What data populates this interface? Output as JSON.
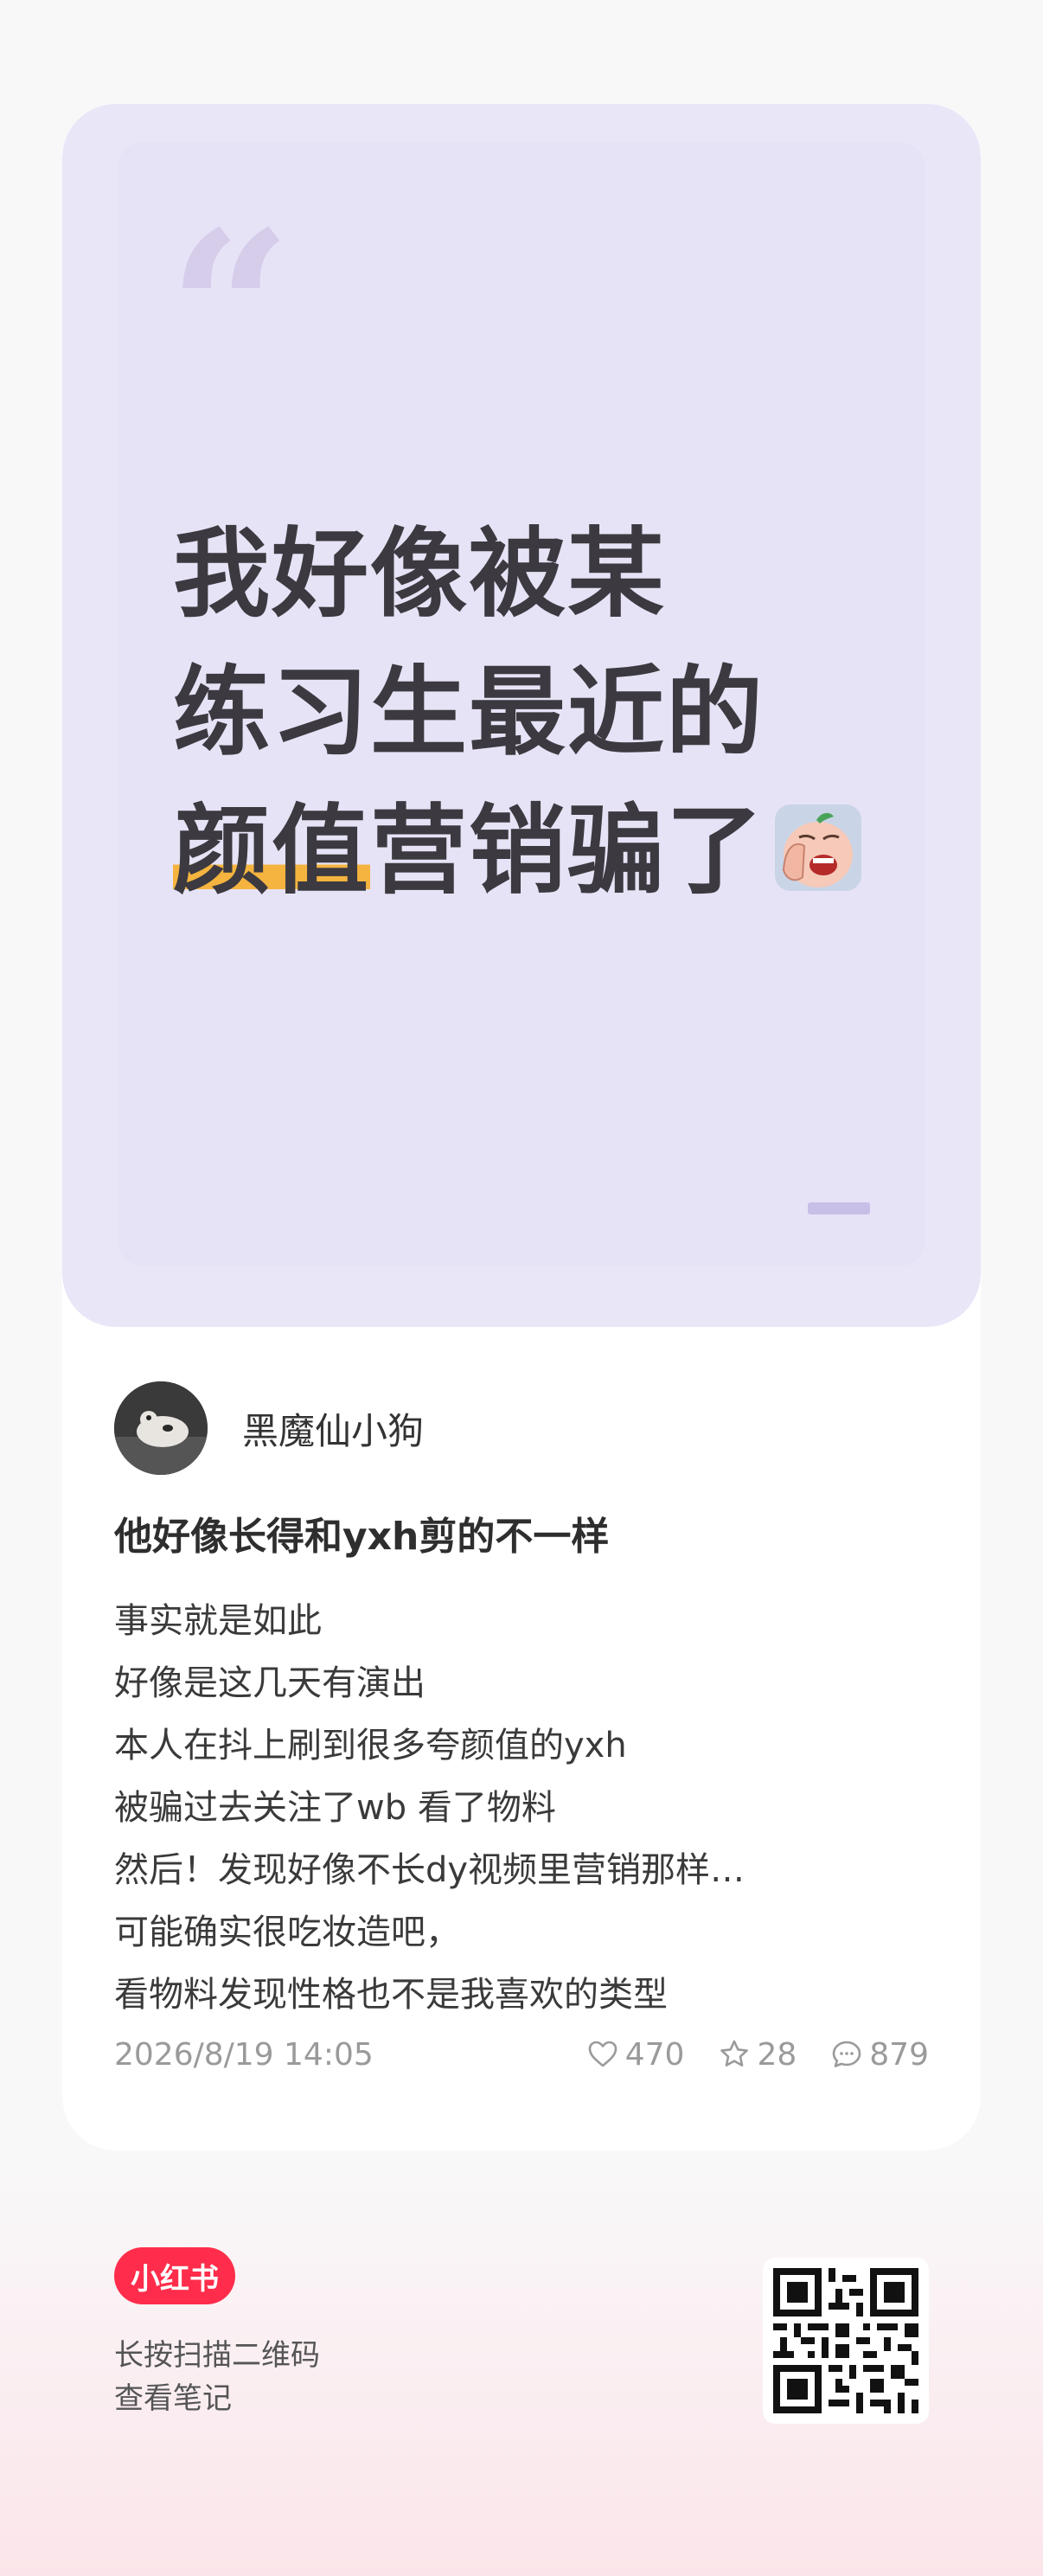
{
  "cover": {
    "quote_glyph": "“",
    "headline_lines": [
      "我好像被某",
      "练习生最近的"
    ],
    "headline_highlight": "颜值",
    "headline_rest": "营销骗了",
    "emoji": "facepalm-emoji"
  },
  "author": {
    "name": "黑魔仙小狗",
    "avatar": "avatar-dog-photo"
  },
  "post": {
    "title": "他好像长得和yxh剪的不一样",
    "lines": [
      "事实就是如此",
      "好像是这几天有演出",
      "本人在抖上刷到很多夸颜值的yxh",
      "被骗过去关注了wb 看了物料",
      "然后！发现好像不长dy视频里营销那样…",
      "可能确实很吃妆造吧，",
      "看物料发现性格也不是我喜欢的类型"
    ],
    "date": "2026/8/19 14:05",
    "likes": "470",
    "favorites": "28",
    "comments": "879"
  },
  "footer": {
    "logo": "小红书",
    "hint_line1": "长按扫描二维码",
    "hint_line2": "查看笔记",
    "qr": "qr-code"
  },
  "colors": {
    "cover_bg": "#e9e6f8",
    "highlight": "#f5b43f",
    "brand": "#ff2d4b"
  }
}
